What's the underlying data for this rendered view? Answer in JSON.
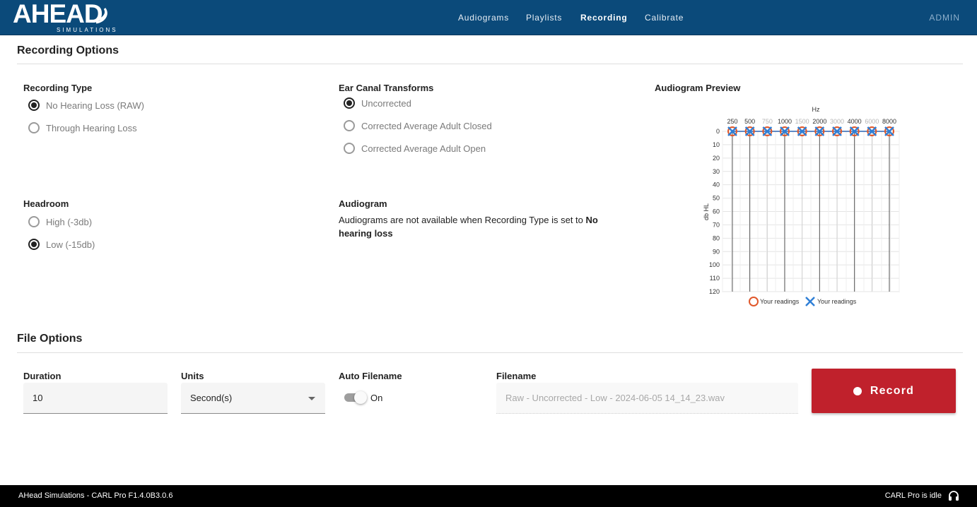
{
  "header": {
    "logo_text": "AHEAD",
    "logo_subtext": "SIMULATIONS",
    "nav": [
      {
        "label": "Audiograms"
      },
      {
        "label": "Playlists"
      },
      {
        "label": "Recording"
      },
      {
        "label": "Calibrate"
      }
    ],
    "active_nav": "Recording",
    "admin_label": "ADMIN",
    "colors": {
      "bar": "#0b4a7a",
      "admin": "#8fb0cc"
    }
  },
  "recording_options": {
    "title": "Recording Options",
    "recording_type": {
      "label": "Recording Type",
      "options": [
        "No Hearing Loss (RAW)",
        "Through Hearing Loss"
      ],
      "selected": "No Hearing Loss (RAW)"
    },
    "ear_canal": {
      "label": "Ear Canal Transforms",
      "options": [
        "Uncorrected",
        "Corrected Average Adult Closed",
        "Corrected Average Adult Open"
      ],
      "selected": "Uncorrected"
    },
    "headroom": {
      "label": "Headroom",
      "options": [
        "High (-3db)",
        "Low (-15db)"
      ],
      "selected": "Low (-15db)"
    },
    "audiogram": {
      "label": "Audiogram",
      "message_prefix": "Audiograms are not available when Recording Type is set to ",
      "message_bold": "No hearing loss"
    },
    "preview": {
      "label": "Audiogram Preview"
    }
  },
  "chart_data": {
    "type": "scatter",
    "title": "",
    "xlabel": "Hz",
    "ylabel": "db HL",
    "x_ticks": [
      "250",
      "500",
      "750",
      "1000",
      "1500",
      "2000",
      "3000",
      "4000",
      "6000",
      "8000"
    ],
    "x_ticks_muted": [
      "750",
      "1500",
      "3000",
      "6000"
    ],
    "y_ticks": [
      0,
      10,
      20,
      30,
      40,
      50,
      60,
      70,
      80,
      90,
      100,
      110,
      120
    ],
    "ylim": [
      0,
      120
    ],
    "y_inverted": true,
    "series": [
      {
        "name": "Your readings",
        "marker": "circle",
        "color": "#e0572a",
        "x": [
          "250",
          "500",
          "750",
          "1000",
          "1500",
          "2000",
          "3000",
          "4000",
          "6000",
          "8000"
        ],
        "values": [
          0,
          0,
          0,
          0,
          0,
          0,
          0,
          0,
          0,
          0
        ]
      },
      {
        "name": "Your readings",
        "marker": "x",
        "color": "#2f7fd6",
        "x": [
          "250",
          "500",
          "750",
          "1000",
          "1500",
          "2000",
          "3000",
          "4000",
          "6000",
          "8000"
        ],
        "values": [
          0,
          0,
          0,
          0,
          0,
          0,
          0,
          0,
          0,
          0
        ]
      }
    ],
    "legend_placement": "bottom"
  },
  "file_options": {
    "title": "File Options",
    "duration": {
      "label": "Duration",
      "value": "10"
    },
    "units": {
      "label": "Units",
      "value": "Second(s)"
    },
    "auto_filename": {
      "label": "Auto Filename",
      "state": "On"
    },
    "filename": {
      "label": "Filename",
      "value": "Raw - Uncorrected - Low  - 2024-06-05 14_14_23.wav"
    },
    "record_button": {
      "label": "Record",
      "color": "#c0212c"
    }
  },
  "footer": {
    "left": "AHead Simulations - CARL Pro F1.4.0B3.0.6",
    "right": "CARL Pro is idle"
  }
}
